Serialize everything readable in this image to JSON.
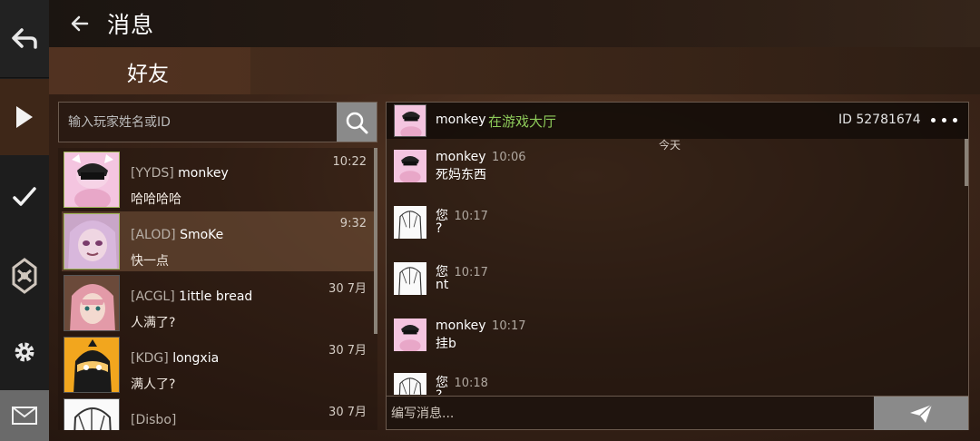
{
  "header": {
    "title": "消息",
    "back_icon": "arrow-left-icon"
  },
  "tabs": {
    "friends": "好友"
  },
  "search": {
    "placeholder": "输入玩家姓名或ID",
    "icon": "search-icon"
  },
  "friends": [
    {
      "tag": "[YYDS]",
      "name": "monkey",
      "time": "10:22",
      "last_message": "哈哈哈哈"
    },
    {
      "tag": "[ALOD]",
      "name": "SmoKe",
      "time": "9:32",
      "last_message": "快一点"
    },
    {
      "tag": "[ACGL]",
      "name": "1ittle  bread",
      "time": "30 7月",
      "last_message": "人满了?"
    },
    {
      "tag": "[KDG]",
      "name": "longxia",
      "time": "30 7月",
      "last_message": "满人了?"
    },
    {
      "tag": "[Disbo]",
      "name": "",
      "time": "30 7月",
      "last_message": ""
    }
  ],
  "chat": {
    "user": "monkey",
    "status": "在游戏大厅",
    "id_text": "ID 52781674",
    "date_divider": "今天",
    "messages": [
      {
        "sender": "monkey",
        "time": "10:06",
        "text": "死妈东西"
      },
      {
        "sender": "您",
        "time": "10:17",
        "text": "?"
      },
      {
        "sender": "您",
        "time": "10:17",
        "text": "nt"
      },
      {
        "sender": "monkey",
        "time": "10:17",
        "text": "挂b"
      },
      {
        "sender": "您",
        "time": "10:18",
        "text": "?"
      }
    ],
    "compose_placeholder": "编写消息...",
    "send_icon": "paper-plane-icon"
  },
  "colors": {
    "status_online": "#8ecb5a",
    "accent_border": "#9fb85a"
  }
}
